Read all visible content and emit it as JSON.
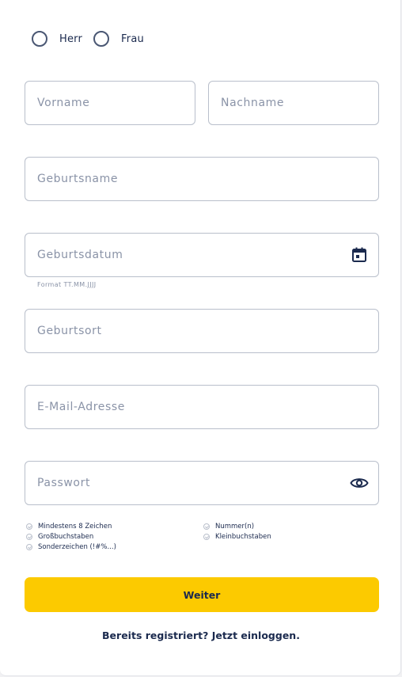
{
  "salutation": {
    "options": [
      {
        "label": "Herr"
      },
      {
        "label": "Frau"
      }
    ]
  },
  "form": {
    "first_name": {
      "placeholder": "Vorname",
      "value": ""
    },
    "last_name": {
      "placeholder": "Nachname",
      "value": ""
    },
    "birth_name": {
      "placeholder": "Geburtsname",
      "value": ""
    },
    "birth_date": {
      "placeholder": "Geburtsdatum",
      "value": "",
      "hint": "Format TT.MM.JJJJ",
      "icon": "calendar-icon"
    },
    "birth_place": {
      "placeholder": "Geburtsort",
      "value": ""
    },
    "email": {
      "placeholder": "E-Mail-Adresse",
      "value": ""
    },
    "password": {
      "placeholder": "Passwort",
      "value": "",
      "icon": "eye-icon"
    }
  },
  "password_requirements": {
    "left": [
      "Mindestens 8 Zeichen",
      "Großbuchstaben",
      "Sonderzeichen (!#%...)"
    ],
    "right": [
      "Nummer(n)",
      "Kleinbuchstaben"
    ]
  },
  "actions": {
    "submit_label": "Weiter",
    "login_link": "Bereits registriert? Jetzt einloggen."
  },
  "colors": {
    "accent": "#fcca00",
    "text": "#1b2a4e",
    "placeholder": "#8a93a7",
    "border": "#b9bfcb"
  }
}
